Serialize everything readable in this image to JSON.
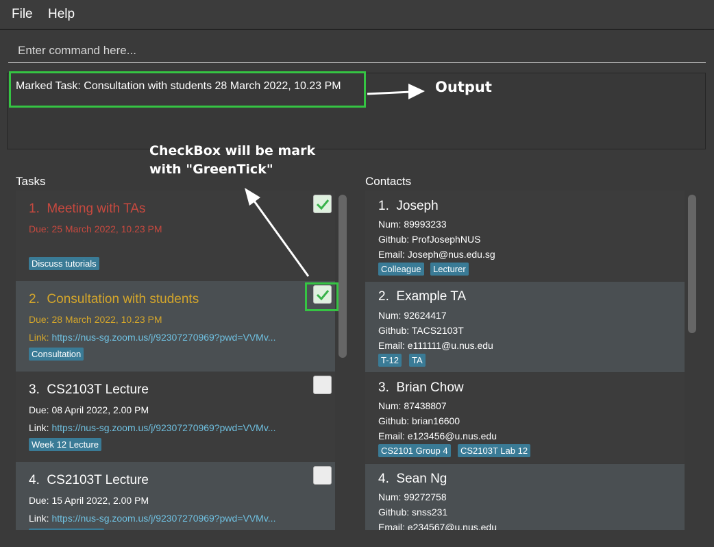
{
  "menu": {
    "file": "File",
    "help": "Help"
  },
  "command": {
    "placeholder": "Enter command here...",
    "value": ""
  },
  "result": {
    "text": "Marked Task: Consultation with students 28 March 2022, 10.23 PM"
  },
  "annotations": {
    "output_label": "Output",
    "checkbox_note_line1": "CheckBox will be mark",
    "checkbox_note_line2": "with \"GreenTick\""
  },
  "tasks": {
    "title": "Tasks",
    "items": [
      {
        "index": "1.",
        "name": "Meeting with TAs",
        "due": "Due: 25 March 2022, 10.23 PM",
        "link_label": "",
        "link": "",
        "tag": "Discuss tutorials",
        "done": true,
        "status": "overdue",
        "color": "#c8493f"
      },
      {
        "index": "2.",
        "name": "Consultation with students",
        "due": "Due: 28 March 2022, 10.23 PM",
        "link_label": "Link:",
        "link": "https://nus-sg.zoom.us/j/92307270969?pwd=VVMv...",
        "tag": "Consultation",
        "done": true,
        "status": "due-soon",
        "color": "#d4a62b"
      },
      {
        "index": "3.",
        "name": "CS2103T Lecture",
        "due": "Due: 08 April 2022, 2.00 PM",
        "link_label": "Link:",
        "link": "https://nus-sg.zoom.us/j/92307270969?pwd=VVMv...",
        "tag": "Week 12 Lecture",
        "done": false,
        "status": "normal",
        "color": "#ffffff"
      },
      {
        "index": "4.",
        "name": "CS2103T Lecture",
        "due": "Due: 15 April 2022, 2.00 PM",
        "link_label": "Link:",
        "link": "https://nus-sg.zoom.us/j/92307270969?pwd=VVMv...",
        "tag": "",
        "done": false,
        "status": "normal",
        "color": "#ffffff"
      }
    ]
  },
  "contacts": {
    "title": "Contacts",
    "items": [
      {
        "index": "1.",
        "name": "Joseph",
        "num": "Num: 89993233",
        "github": "Github: ProfJosephNUS",
        "email": "Email: Joseph@nus.edu.sg",
        "tags": [
          "Colleague",
          "Lecturer"
        ]
      },
      {
        "index": "2.",
        "name": "Example TA",
        "num": "Num: 92624417",
        "github": "Github: TACS2103T",
        "email": "Email: e111111@u.nus.edu",
        "tags": [
          "T-12",
          "TA"
        ]
      },
      {
        "index": "3.",
        "name": "Brian Chow",
        "num": "Num: 87438807",
        "github": "Github: brian16600",
        "email": "Email: e123456@u.nus.edu",
        "tags": [
          "CS2101 Group 4",
          "CS2103T Lab 12"
        ]
      },
      {
        "index": "4.",
        "name": "Sean Ng",
        "num": "Num: 99272758",
        "github": "Github: snss231",
        "email": "Email: e234567@u.nus.edu",
        "tags": []
      }
    ]
  },
  "colors": {
    "highlight": "#35c443",
    "tag_bg": "#3a7b96",
    "link": "#6fc0e0"
  }
}
